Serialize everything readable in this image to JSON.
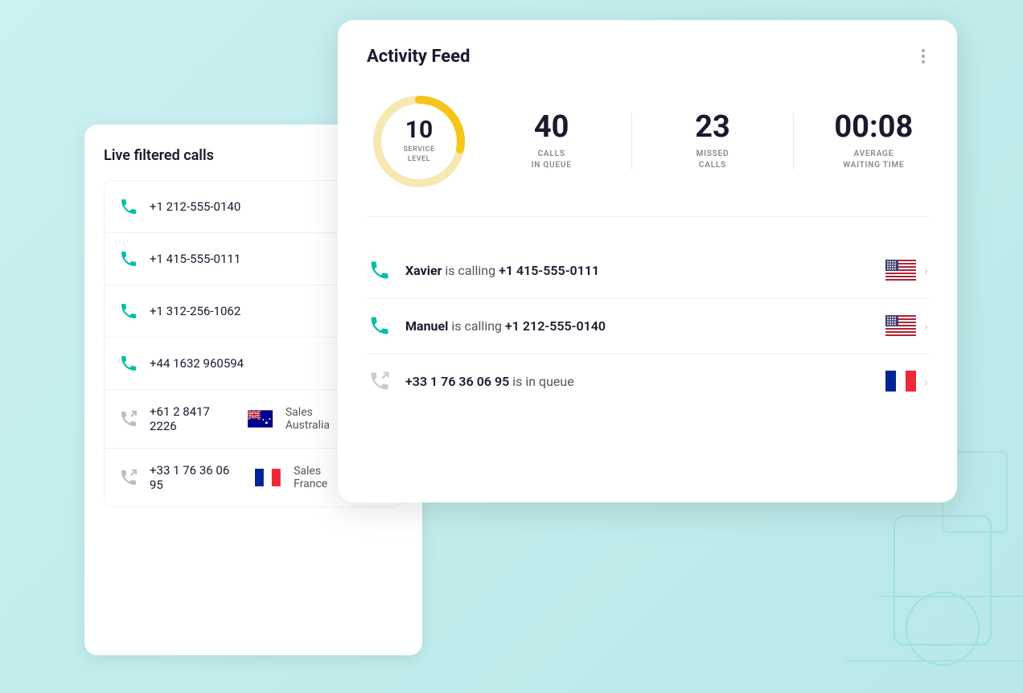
{
  "background_color": "#ceeaea",
  "left_panel": {
    "title": "Live filtered calls",
    "calls": [
      {
        "number": "+1 212-555-0140",
        "type": "incoming",
        "icon": "phone-incoming"
      },
      {
        "number": "+1 415-555-0111",
        "type": "incoming",
        "icon": "phone-incoming"
      },
      {
        "number": "+1 312-256-1062",
        "type": "incoming",
        "icon": "phone-incoming"
      },
      {
        "number": "+44 1632 960594",
        "type": "incoming",
        "icon": "phone-incoming"
      },
      {
        "number": "+61 2 8417 2226",
        "type": "outgoing",
        "icon": "phone-outgoing",
        "sales": "Sales Australia",
        "flag": "au"
      },
      {
        "number": "+33 1 76 36 06 95",
        "type": "outgoing",
        "icon": "phone-outgoing",
        "sales": "Sales France",
        "flag": "fr"
      }
    ]
  },
  "activity_feed": {
    "title": "Activity Feed",
    "more_icon_label": "more-options",
    "stats": {
      "service_level": {
        "value": "10",
        "label": "SERVICE\nLEVEL",
        "donut_percent": 28,
        "color_filled": "#f5c518",
        "color_empty": "#f0e8c8"
      },
      "calls_in_queue": {
        "value": "40",
        "label": "CALLS\nIN QUEUE"
      },
      "missed_calls": {
        "value": "23",
        "label": "MISSED\nCALLS"
      },
      "average_waiting_time": {
        "value": "00:08",
        "label": "AVERAGE\nWAITING TIME"
      }
    },
    "call_rows": [
      {
        "caller": "Xavier",
        "status": "is calling",
        "number": "+1 415-555-0111",
        "flag": "us",
        "type": "active"
      },
      {
        "caller": "Manuel",
        "status": "is calling",
        "number": "+1 212-555-0140",
        "flag": "us",
        "type": "active"
      },
      {
        "caller": "+33 1 76 36 06 95",
        "status": "is in queue",
        "number": "",
        "flag": "fr",
        "type": "queue"
      }
    ]
  }
}
